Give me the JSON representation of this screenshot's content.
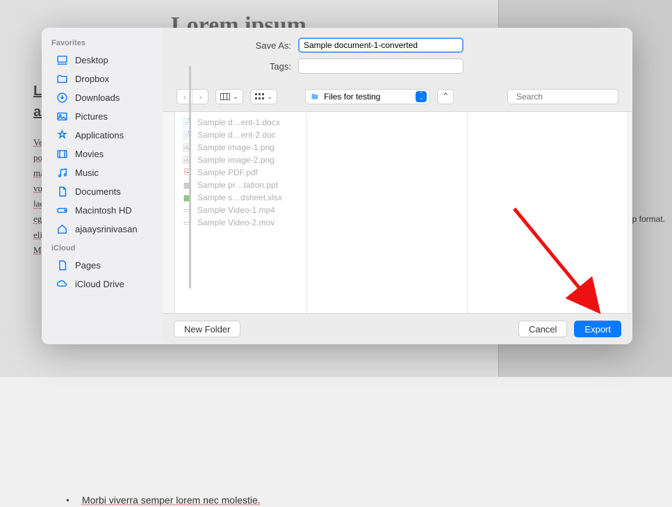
{
  "background": {
    "title": "Lorem ipsum",
    "subtitle1": "L",
    "subtitle2": "ac",
    "para": "Ves por ma vul lac ege elit Ma",
    "bullet": "Morbi viverra semper lorem nec molestie.",
    "rightpanel_format": "p format."
  },
  "dialog": {
    "save_as_label": "Save As:",
    "save_as_value": "Sample document-1-converted",
    "tags_label": "Tags:",
    "tags_value": "",
    "folder_label": "Files for testing",
    "search_placeholder": "Search",
    "new_folder_label": "New Folder",
    "cancel_label": "Cancel",
    "export_label": "Export"
  },
  "sidebar": {
    "favorites_label": "Favorites",
    "items": [
      {
        "label": "Desktop"
      },
      {
        "label": "Dropbox"
      },
      {
        "label": "Downloads"
      },
      {
        "label": "Pictures"
      },
      {
        "label": "Applications"
      },
      {
        "label": "Movies"
      },
      {
        "label": "Music"
      },
      {
        "label": "Documents"
      },
      {
        "label": "Macintosh HD"
      },
      {
        "label": "ajaaysrinivasan"
      }
    ],
    "icloud_label": "iCloud",
    "icloud_items": [
      {
        "label": "Pages"
      },
      {
        "label": "iCloud Drive"
      }
    ]
  },
  "files": [
    {
      "label": "Sample d…ent-1.docx",
      "icon": "doc"
    },
    {
      "label": "Sample d…ent-2.doc",
      "icon": "doc"
    },
    {
      "label": "Sample image-1.png",
      "icon": "img"
    },
    {
      "label": "Sample image-2.png",
      "icon": "img"
    },
    {
      "label": "Sample PDF.pdf",
      "icon": "pdf"
    },
    {
      "label": "Sample pr…tation.ppt",
      "icon": "ppt"
    },
    {
      "label": "Sample s…dsheet.xlsx",
      "icon": "xls"
    },
    {
      "label": "Sample Video-1.mp4",
      "icon": "vid"
    },
    {
      "label": "Sample Video-2.mov",
      "icon": "vid"
    }
  ]
}
